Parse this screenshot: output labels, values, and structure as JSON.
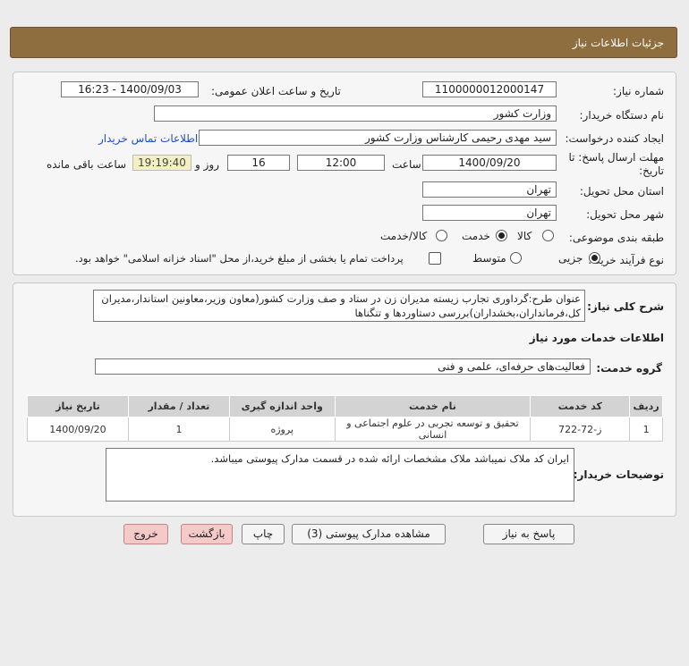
{
  "header": {
    "title": "جزئیات اطلاعات نیاز"
  },
  "form": {
    "need_number_label": "شماره نیاز:",
    "need_number": "1100000012000147",
    "announce_label": "تاریخ و ساعت اعلان عمومی:",
    "announce_value": "1400/09/03 - 16:23",
    "buyer_org_label": "نام دستگاه خریدار:",
    "buyer_org": "وزارت کشور",
    "creator_label": "ایجاد کننده درخواست:",
    "creator": "سید مهدی رحیمی کارشناس وزارت کشور",
    "contact_link": "اطلاعات تماس خریدار",
    "deadline_label_1": "مهلت ارسال پاسخ: تا",
    "deadline_label_2": "تاریخ:",
    "deadline_date": "1400/09/20",
    "time_label": "ساعت",
    "deadline_time": "12:00",
    "days_value": "16",
    "days_label": "روز و",
    "remaining_time": "19:19:40",
    "remaining_label": "ساعت باقی مانده",
    "province_label": "استان محل تحویل:",
    "province": "تهران",
    "city_label": "شهر محل تحویل:",
    "city": "تهران",
    "category_label": "طبقه بندی موضوعی:",
    "category_options": [
      "کالا",
      "خدمت",
      "کالا/خدمت"
    ],
    "category_selected": "خدمت",
    "process_label": "نوع فرآیند خرید :",
    "process_options": [
      "جزیی",
      "متوسط"
    ],
    "process_selected": "جزیی",
    "payment_text": "پرداخت تمام یا بخشی از مبلغ خرید،از محل \"اسناد خزانه اسلامی\" خواهد بود."
  },
  "details": {
    "summary_label": "شرح کلی نیاز:",
    "summary_text": "عنوان طرح:گرداوری تجارب زیسته مدیران زن در ستاد و صف وزارت کشور(معاون وزیر،معاونین استاندار،مدیران کل،فرمانداران،بخشداران)بررسی دستاوردها و تنگناها",
    "services_heading": "اطلاعات خدمات مورد نیاز",
    "service_group_label": "گروه خدمت:",
    "service_group": "فعالیت‌های حرفه‌ای، علمی و فنی",
    "table": {
      "headers": [
        "ردیف",
        "کد خدمت",
        "نام خدمت",
        "واحد اندازه گیری",
        "تعداد / مقدار",
        "تاریخ نیاز"
      ],
      "rows": [
        [
          "1",
          "ز-72-722",
          "تحقیق و توسعه تجربی در علوم اجتماعی و انسانی",
          "پروژه",
          "1",
          "1400/09/20"
        ]
      ]
    },
    "buyer_notes_label": "توضیحات خریدار:",
    "buyer_notes": "ایران کد ملاک نمیباشد ملاک مشخصات ارائه شده در قسمت مدارک پیوستی میباشد."
  },
  "buttons": {
    "reply": "پاسخ به نیاز",
    "attachments": "مشاهده مدارک پیوستی (3)",
    "print": "چاپ",
    "back": "بازگشت",
    "exit": "خروج"
  },
  "colors": {
    "header": "#8e6d3e",
    "exit_button": "#f6c9c9",
    "link": "#1f4fc8"
  }
}
